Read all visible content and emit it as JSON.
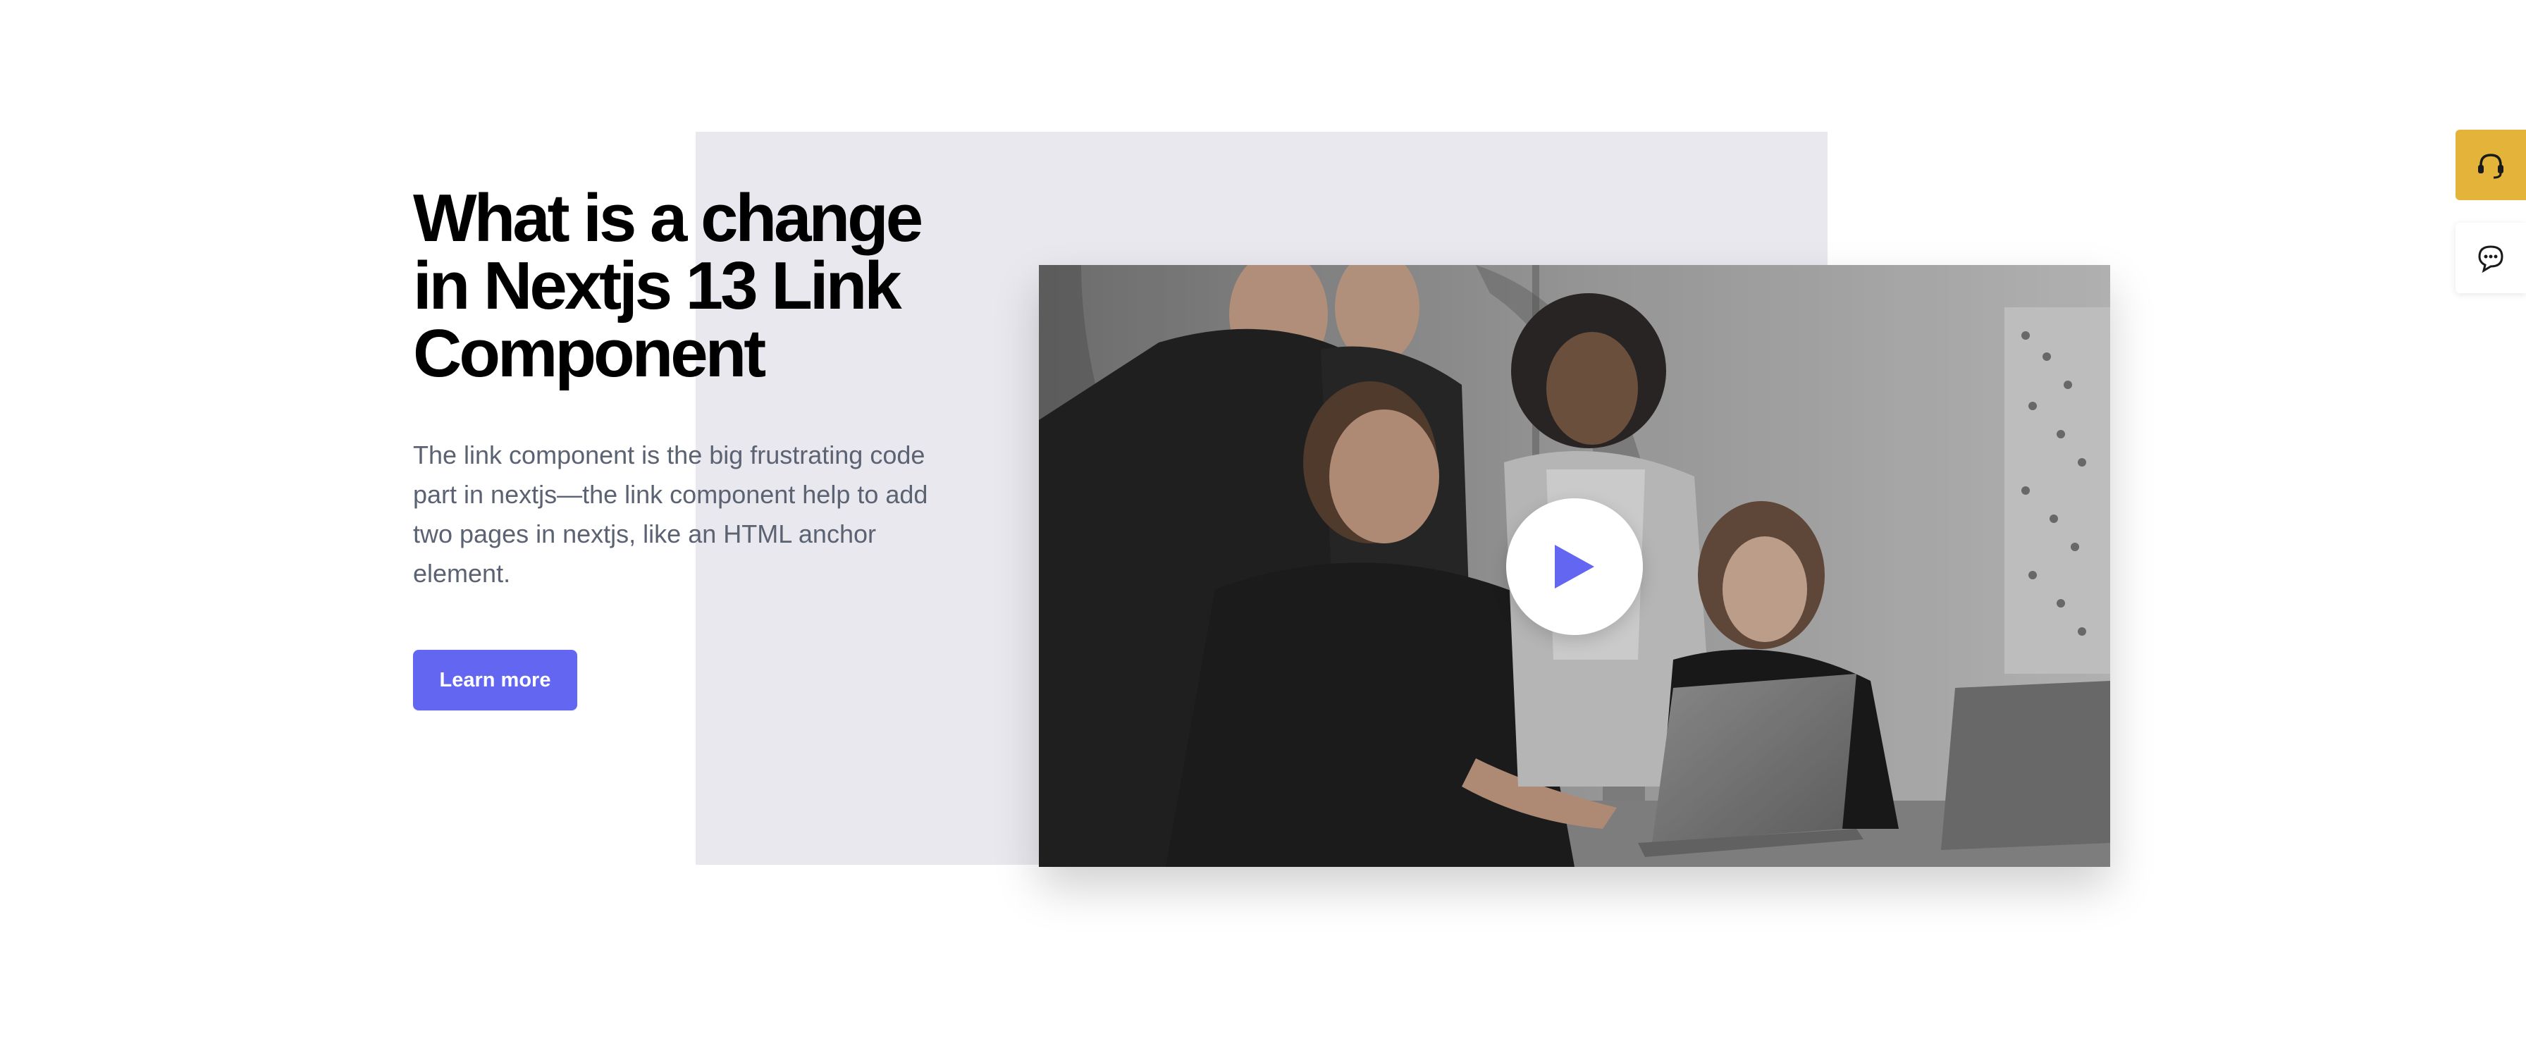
{
  "hero": {
    "title_line1": "What is a change",
    "title_line2": "in Nextjs 13 Link",
    "title_line3": "Component",
    "description": "The link component is the big frustrating code part in nextjs—the link component help to add two pages in nextjs, like an HTML anchor element.",
    "cta_label": "Learn more"
  },
  "media": {
    "image": "team-at-laptop-photo",
    "play_icon": "play-icon"
  },
  "side_widgets": {
    "support_icon": "headset-icon",
    "chat_icon": "chat-bubble-icon"
  },
  "colors": {
    "accent": "#6366f1",
    "panel": "#e9e8ee",
    "support": "#e4b43a",
    "text_muted": "#5b6272"
  }
}
